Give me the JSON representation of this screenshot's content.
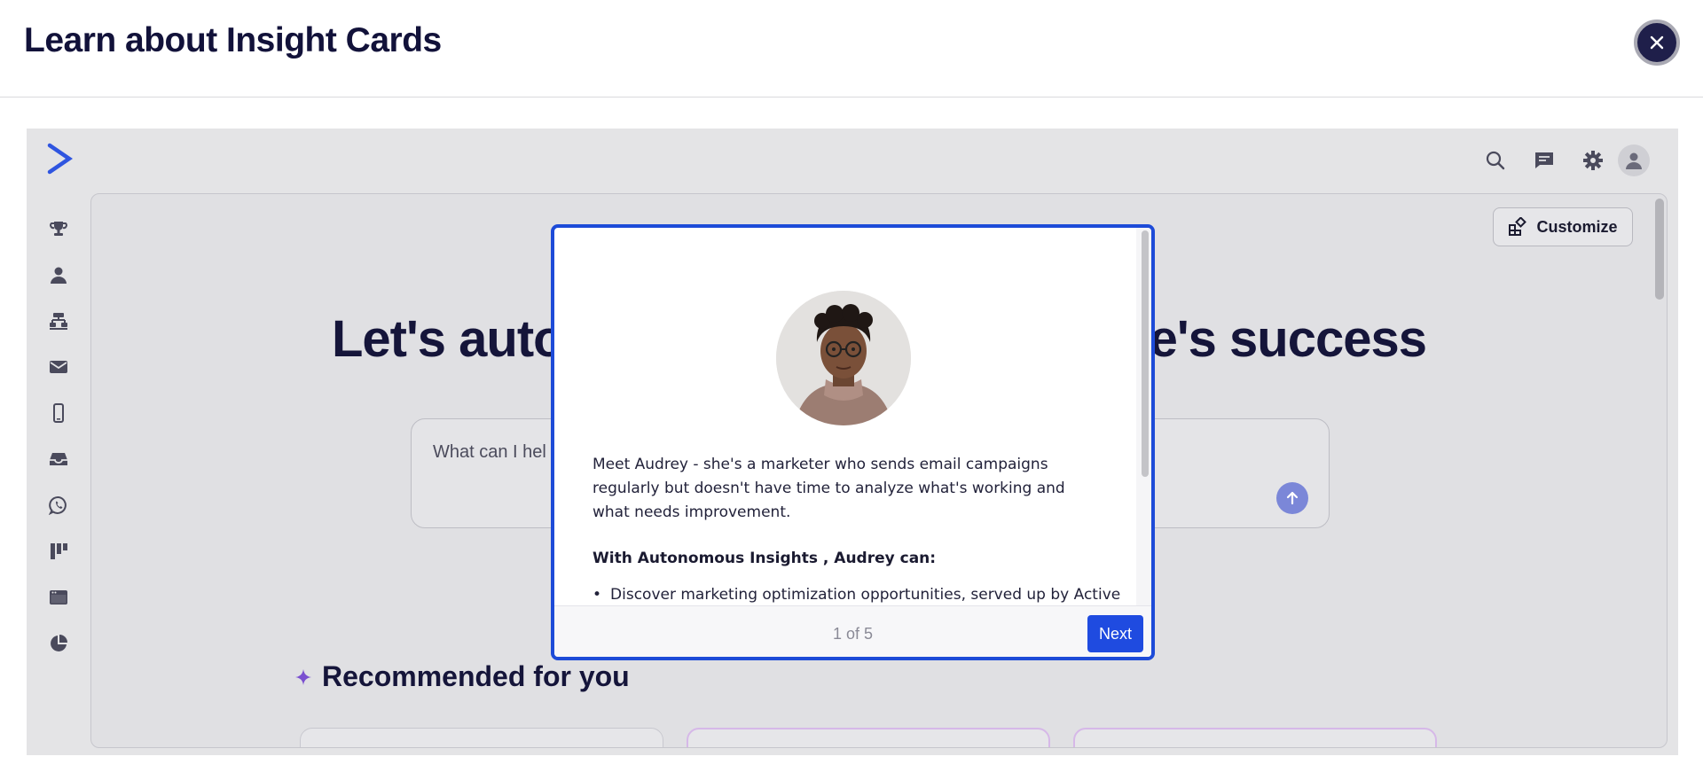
{
  "header": {
    "title": "Learn about Insight Cards",
    "close_icon": "close-icon"
  },
  "app": {
    "logo_icon": "activecampaign-chevron-logo",
    "sidebar": {
      "items": [
        {
          "icon": "trophy-icon"
        },
        {
          "icon": "contact-person-icon"
        },
        {
          "icon": "automations-sitemap-icon"
        },
        {
          "icon": "email-envelope-icon"
        },
        {
          "icon": "mobile-phone-icon"
        },
        {
          "icon": "inbox-tray-icon"
        },
        {
          "icon": "whatsapp-icon"
        },
        {
          "icon": "kanban-board-icon"
        },
        {
          "icon": "website-browser-icon"
        },
        {
          "icon": "reports-pie-chart-icon"
        }
      ]
    },
    "topnav": {
      "icons": [
        "search-icon",
        "chat-icon",
        "gear-icon",
        "user-avatar-icon"
      ]
    },
    "customize_label": "Customize",
    "hero_left": "Let's auto",
    "hero_right": "e's success",
    "prompt_placeholder": "What can I hel",
    "recommended_title": "Recommended for you"
  },
  "modal": {
    "photo_alt": "Audrey",
    "paragraph": "Meet Audrey - she's a marketer who sends email campaigns regularly but doesn't have time to analyze what's working and what needs improvement.",
    "subheading": "With Autonomous Insights , Audrey can:",
    "bullets": [
      "Discover marketing optimization opportunities, served up by Active"
    ],
    "page_indicator": "1 of 5",
    "next_label": "Next"
  },
  "colors": {
    "accent": "#1d4bd8",
    "title_text": "#12123a",
    "overlay": "#e4e4e6"
  }
}
